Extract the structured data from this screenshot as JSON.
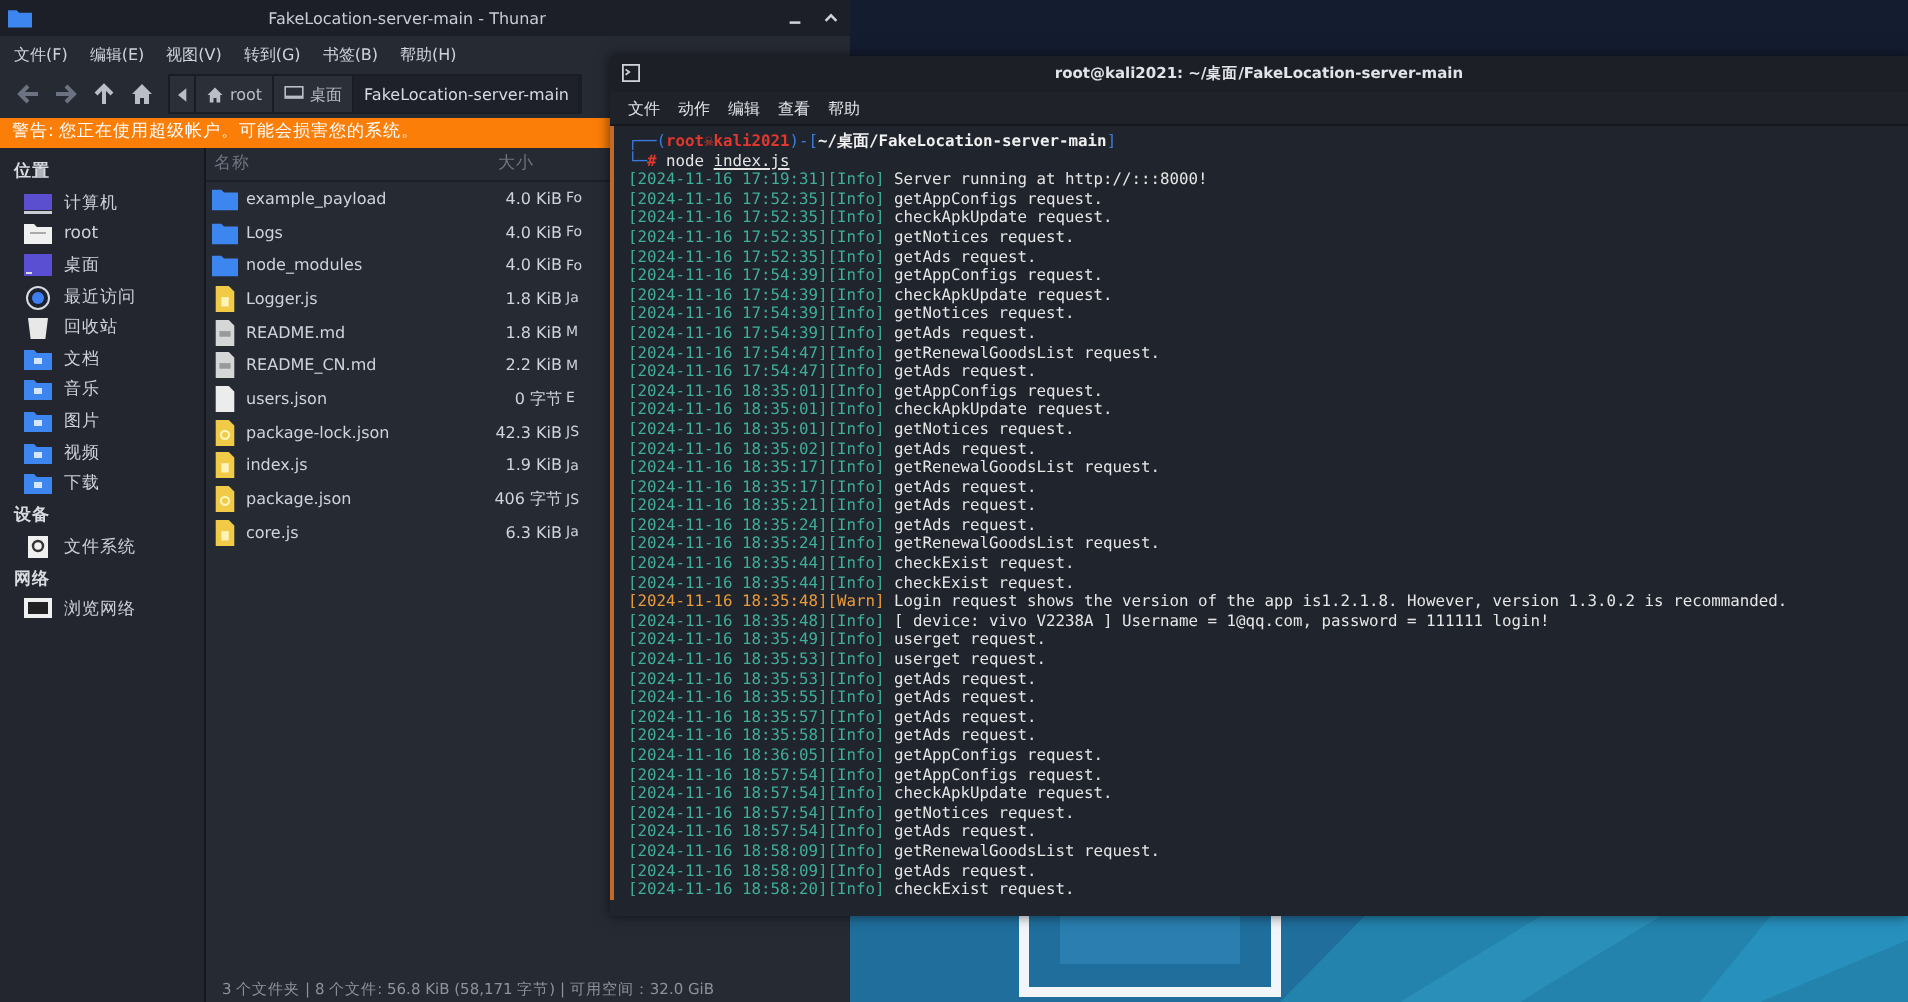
{
  "thunar": {
    "title": "FakeLocation-server-main - Thunar",
    "menu": [
      "文件(F)",
      "编辑(E)",
      "视图(V)",
      "转到(G)",
      "书签(B)",
      "帮助(H)"
    ],
    "path": [
      {
        "label": "root",
        "kind": "home",
        "selected": false
      },
      {
        "label": "桌面",
        "kind": "desktop",
        "selected": false
      },
      {
        "label": "FakeLocation-server-main",
        "kind": "folder",
        "selected": true
      }
    ],
    "warning": "警告: 您正在使用超级帐户。可能会损害您的系统。",
    "sidebar": [
      {
        "heading": "位置",
        "items": [
          {
            "label": "计算机",
            "kind": "computer"
          },
          {
            "label": "root",
            "kind": "home"
          },
          {
            "label": "桌面",
            "kind": "desktop"
          },
          {
            "label": "最近访问",
            "kind": "recent"
          },
          {
            "label": "回收站",
            "kind": "trash"
          },
          {
            "label": "文档",
            "kind": "folder"
          },
          {
            "label": "音乐",
            "kind": "folder"
          },
          {
            "label": "图片",
            "kind": "folder"
          },
          {
            "label": "视频",
            "kind": "folder"
          },
          {
            "label": "下载",
            "kind": "folder"
          }
        ]
      },
      {
        "heading": "设备",
        "items": [
          {
            "label": "文件系统",
            "kind": "drive"
          }
        ]
      },
      {
        "heading": "网络",
        "items": [
          {
            "label": "浏览网络",
            "kind": "network"
          }
        ]
      }
    ],
    "columns": [
      "名称",
      "大小"
    ],
    "files": [
      {
        "name": "example_payload",
        "size": "4.0 KiB",
        "column_3": "Fo",
        "kind": "folder"
      },
      {
        "name": "Logs",
        "size": "4.0 KiB",
        "column_3": "Fo",
        "kind": "folder"
      },
      {
        "name": "node_modules",
        "size": "4.0 KiB",
        "column_3": "Fo",
        "kind": "folder"
      },
      {
        "name": "Logger.js",
        "size": "1.8 KiB",
        "column_3": "Ja",
        "kind": "script"
      },
      {
        "name": "README.md",
        "size": "1.8 KiB",
        "column_3": "M",
        "kind": "text"
      },
      {
        "name": "README_CN.md",
        "size": "2.2 KiB",
        "column_3": "M",
        "kind": "text"
      },
      {
        "name": "users.json",
        "size": "0 字节",
        "column_3": "E",
        "kind": "blank"
      },
      {
        "name": "package-lock.json",
        "size": "42.3 KiB",
        "column_3": "JS",
        "kind": "data"
      },
      {
        "name": "index.js",
        "size": "1.9 KiB",
        "column_3": "Ja",
        "kind": "script"
      },
      {
        "name": "package.json",
        "size": "406 字节",
        "column_3": "JS",
        "kind": "data"
      },
      {
        "name": "core.js",
        "size": "6.3 KiB",
        "column_3": "Ja",
        "kind": "script"
      }
    ],
    "status_bar": "3 个文件夹 | 8 个文件: 56.8 KiB (58,171 字节) | 可用空间：32.0 GiB"
  },
  "terminal": {
    "title": "root@kali2021: ~/桌面/FakeLocation-server-main",
    "menu": [
      "文件",
      "动作",
      "编辑",
      "查看",
      "帮助"
    ],
    "prompt": [
      {
        "text": "┌──(",
        "kind": "frame"
      },
      {
        "text": "root☠kali2021",
        "kind": "user"
      },
      {
        "text": ")-[",
        "kind": "frame"
      },
      {
        "text": "~/桌面/FakeLocation-server-main",
        "kind": "path"
      },
      {
        "text": "]",
        "kind": "frame"
      }
    ],
    "command": [
      {
        "text": "└─",
        "kind": "frame"
      },
      {
        "text": "#",
        "kind": "user"
      },
      {
        "text": " node ",
        "kind": "plain"
      },
      {
        "text": "index.js",
        "kind": "link"
      }
    ],
    "log": [
      {
        "stamp": "[2024-11-16 17:19:31]",
        "tag": "[Info]",
        "message": "Server running at http://:::8000!",
        "kind": "info"
      },
      {
        "stamp": "[2024-11-16 17:52:35]",
        "tag": "[Info]",
        "message": "getAppConfigs request.",
        "kind": "info"
      },
      {
        "stamp": "[2024-11-16 17:52:35]",
        "tag": "[Info]",
        "message": "checkApkUpdate request.",
        "kind": "info"
      },
      {
        "stamp": "[2024-11-16 17:52:35]",
        "tag": "[Info]",
        "message": "getNotices request.",
        "kind": "info"
      },
      {
        "stamp": "[2024-11-16 17:52:35]",
        "tag": "[Info]",
        "message": "getAds request.",
        "kind": "info"
      },
      {
        "stamp": "[2024-11-16 17:54:39]",
        "tag": "[Info]",
        "message": "getAppConfigs request.",
        "kind": "info"
      },
      {
        "stamp": "[2024-11-16 17:54:39]",
        "tag": "[Info]",
        "message": "checkApkUpdate request.",
        "kind": "info"
      },
      {
        "stamp": "[2024-11-16 17:54:39]",
        "tag": "[Info]",
        "message": "getNotices request.",
        "kind": "info"
      },
      {
        "stamp": "[2024-11-16 17:54:39]",
        "tag": "[Info]",
        "message": "getAds request.",
        "kind": "info"
      },
      {
        "stamp": "[2024-11-16 17:54:47]",
        "tag": "[Info]",
        "message": "getRenewalGoodsList request.",
        "kind": "info"
      },
      {
        "stamp": "[2024-11-16 17:54:47]",
        "tag": "[Info]",
        "message": "getAds request.",
        "kind": "info"
      },
      {
        "stamp": "[2024-11-16 18:35:01]",
        "tag": "[Info]",
        "message": "getAppConfigs request.",
        "kind": "info"
      },
      {
        "stamp": "[2024-11-16 18:35:01]",
        "tag": "[Info]",
        "message": "checkApkUpdate request.",
        "kind": "info"
      },
      {
        "stamp": "[2024-11-16 18:35:01]",
        "tag": "[Info]",
        "message": "getNotices request.",
        "kind": "info"
      },
      {
        "stamp": "[2024-11-16 18:35:02]",
        "tag": "[Info]",
        "message": "getAds request.",
        "kind": "info"
      },
      {
        "stamp": "[2024-11-16 18:35:17]",
        "tag": "[Info]",
        "message": "getRenewalGoodsList request.",
        "kind": "info"
      },
      {
        "stamp": "[2024-11-16 18:35:17]",
        "tag": "[Info]",
        "message": "getAds request.",
        "kind": "info"
      },
      {
        "stamp": "[2024-11-16 18:35:21]",
        "tag": "[Info]",
        "message": "getAds request.",
        "kind": "info"
      },
      {
        "stamp": "[2024-11-16 18:35:24]",
        "tag": "[Info]",
        "message": "getAds request.",
        "kind": "info"
      },
      {
        "stamp": "[2024-11-16 18:35:24]",
        "tag": "[Info]",
        "message": "getRenewalGoodsList request.",
        "kind": "info"
      },
      {
        "stamp": "[2024-11-16 18:35:44]",
        "tag": "[Info]",
        "message": "checkExist request.",
        "kind": "info"
      },
      {
        "stamp": "[2024-11-16 18:35:44]",
        "tag": "[Info]",
        "message": "checkExist request.",
        "kind": "info"
      },
      {
        "stamp": "[2024-11-16 18:35:48]",
        "tag": "[Warn]",
        "message": "Login request shows the version of the app is1.2.1.8. However, version 1.3.0.2 is recommanded.",
        "kind": "warn"
      },
      {
        "stamp": "[2024-11-16 18:35:48]",
        "tag": "[Info]",
        "message": "[ device: vivo V2238A ] Username = 1@qq.com, password = 111111 login!",
        "kind": "info"
      },
      {
        "stamp": "[2024-11-16 18:35:49]",
        "tag": "[Info]",
        "message": "userget request.",
        "kind": "info"
      },
      {
        "stamp": "[2024-11-16 18:35:53]",
        "tag": "[Info]",
        "message": "userget request.",
        "kind": "info"
      },
      {
        "stamp": "[2024-11-16 18:35:53]",
        "tag": "[Info]",
        "message": "getAds request.",
        "kind": "info"
      },
      {
        "stamp": "[2024-11-16 18:35:55]",
        "tag": "[Info]",
        "message": "getAds request.",
        "kind": "info"
      },
      {
        "stamp": "[2024-11-16 18:35:57]",
        "tag": "[Info]",
        "message": "getAds request.",
        "kind": "info"
      },
      {
        "stamp": "[2024-11-16 18:35:58]",
        "tag": "[Info]",
        "message": "getAds request.",
        "kind": "info"
      },
      {
        "stamp": "[2024-11-16 18:36:05]",
        "tag": "[Info]",
        "message": "getAppConfigs request.",
        "kind": "info"
      },
      {
        "stamp": "[2024-11-16 18:57:54]",
        "tag": "[Info]",
        "message": "getAppConfigs request.",
        "kind": "info"
      },
      {
        "stamp": "[2024-11-16 18:57:54]",
        "tag": "[Info]",
        "message": "checkApkUpdate request.",
        "kind": "info"
      },
      {
        "stamp": "[2024-11-16 18:57:54]",
        "tag": "[Info]",
        "message": "getNotices request.",
        "kind": "info"
      },
      {
        "stamp": "[2024-11-16 18:57:54]",
        "tag": "[Info]",
        "message": "getAds request.",
        "kind": "info"
      },
      {
        "stamp": "[2024-11-16 18:58:09]",
        "tag": "[Info]",
        "message": "getRenewalGoodsList request.",
        "kind": "info"
      },
      {
        "stamp": "[2024-11-16 18:58:09]",
        "tag": "[Info]",
        "message": "getAds request.",
        "kind": "info"
      },
      {
        "stamp": "[2024-11-16 18:58:20]",
        "tag": "[Info]",
        "message": "checkExist request.",
        "kind": "info"
      }
    ]
  }
}
